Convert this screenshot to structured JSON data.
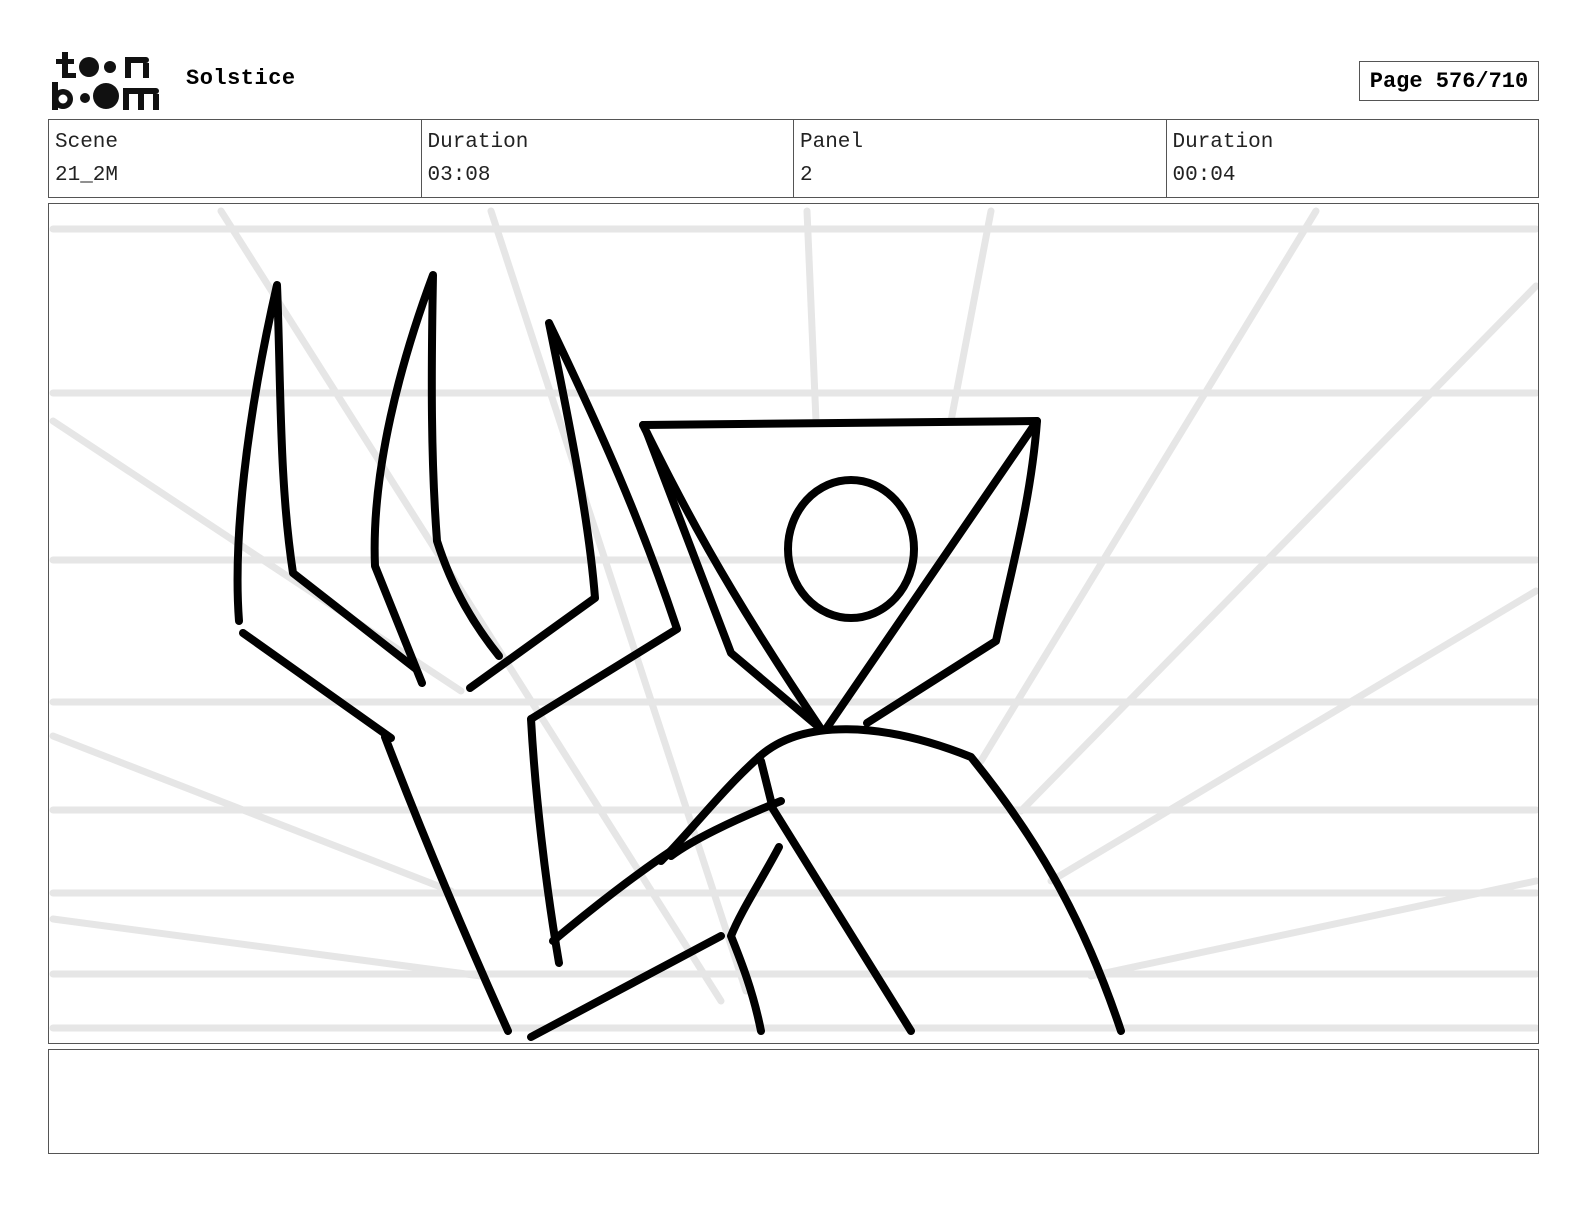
{
  "header": {
    "logo_text": "toon boom",
    "project_title": "Solstice",
    "page_label": "Page 576/710"
  },
  "info": [
    {
      "label": "Scene",
      "value": "21_2M"
    },
    {
      "label": "Duration",
      "value": "03:08"
    },
    {
      "label": "Panel",
      "value": "2"
    },
    {
      "label": "Duration",
      "value": "00:04"
    }
  ],
  "notes": {
    "text": ""
  },
  "colors": {
    "ink": "#000000",
    "guide_lines": "#e6e6e6",
    "border": "#555555"
  }
}
